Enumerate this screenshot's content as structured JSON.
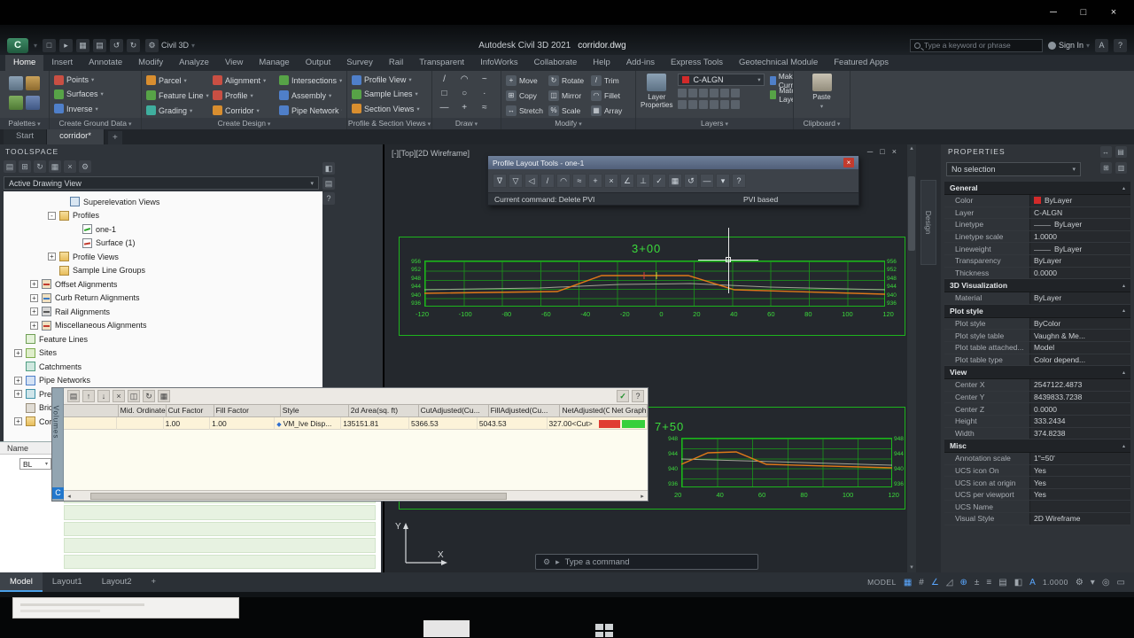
{
  "colors": {
    "accent_green": "#1db41d",
    "profile_design_line": "#e07818",
    "graph_red": "#e03c32",
    "graph_green": "#37d03c",
    "layer_swatch": "#d22a2a"
  },
  "window": {
    "minimize": "─",
    "maximize": "□",
    "close": "×"
  },
  "app": {
    "logo": "C",
    "qat_icons": [
      {
        "name": "new-file-icon",
        "g": "□"
      },
      {
        "name": "open-icon",
        "g": "▸"
      },
      {
        "name": "save-icon",
        "g": "▦"
      },
      {
        "name": "plot-icon",
        "g": "▤"
      },
      {
        "name": "undo-icon",
        "g": "↺"
      },
      {
        "name": "redo-icon",
        "g": "↻"
      }
    ],
    "workspace": "Civil 3D",
    "title": "Autodesk Civil 3D 2021",
    "doc": "corridor.dwg",
    "search_placeholder": "Type a keyword or phrase",
    "sign_in": "Sign In"
  },
  "ribbon": {
    "tabs": [
      {
        "label": "Home",
        "cls": "active"
      },
      {
        "label": "Insert"
      },
      {
        "label": "Annotate"
      },
      {
        "label": "Modify"
      },
      {
        "label": "Analyze"
      },
      {
        "label": "View"
      },
      {
        "label": "Manage"
      },
      {
        "label": "Output"
      },
      {
        "label": "Survey"
      },
      {
        "label": "Rail"
      },
      {
        "label": "Transparent"
      },
      {
        "label": "InfoWorks"
      },
      {
        "label": "Collaborate"
      },
      {
        "label": "Help"
      },
      {
        "label": "Add-ins"
      },
      {
        "label": "Express Tools"
      },
      {
        "label": "Geotechnical Module"
      },
      {
        "label": "Featured Apps"
      }
    ],
    "palettes": {
      "label": "Palettes"
    },
    "ground": {
      "label": "Create Ground Data",
      "buttons": [
        {
          "label": "Points",
          "c": "r"
        },
        {
          "label": "Surfaces",
          "c": "g"
        },
        {
          "label": "Inverse",
          "c": "b"
        }
      ]
    },
    "design": {
      "label": "Create Design",
      "buttons": [
        {
          "label": "Parcel",
          "c": "o"
        },
        {
          "label": "Alignment",
          "c": "r"
        },
        {
          "label": "Intersections",
          "c": "g"
        },
        {
          "label": "Feature Line",
          "c": "g"
        },
        {
          "label": "Profile",
          "c": "r"
        },
        {
          "label": "Assembly",
          "c": "b"
        },
        {
          "label": "Grading",
          "c": "t"
        },
        {
          "label": "Corridor",
          "c": "o"
        },
        {
          "label": "Pipe Network",
          "c": "b"
        }
      ]
    },
    "psv": {
      "label": "Profile & Section Views",
      "buttons": [
        {
          "label": "Profile View",
          "c": "b"
        },
        {
          "label": "Sample Lines",
          "c": "g"
        },
        {
          "label": "Section Views",
          "c": "o"
        }
      ]
    },
    "draw": {
      "label": "Draw",
      "glyphs": [
        "/",
        "◠",
        "~",
        "□",
        "○",
        "·",
        "—",
        "+",
        "≈"
      ]
    },
    "modify": {
      "label": "Modify",
      "buttons": [
        {
          "label": "Move",
          "g": "+"
        },
        {
          "label": "Rotate",
          "g": "↻"
        },
        {
          "label": "Trim",
          "g": "/"
        },
        {
          "label": "Copy",
          "g": "⊞"
        },
        {
          "label": "Mirror",
          "g": "◫"
        },
        {
          "label": "Fillet",
          "g": "◠"
        },
        {
          "label": "Stretch",
          "g": "↔"
        },
        {
          "label": "Scale",
          "g": "%"
        },
        {
          "label": "Array",
          "g": "▦"
        }
      ]
    },
    "layers": {
      "label": "Layers",
      "big_button": "Layer Properties",
      "layer_combo": "C-ALGN",
      "make_current": "Make Current",
      "match_layer": "Match Layer"
    },
    "clipboard": {
      "label": "Clipboard",
      "big_button": "Paste"
    }
  },
  "filetabs": [
    {
      "label": "Start"
    },
    {
      "label": "corridor*",
      "cls": "active"
    }
  ],
  "toolspace": {
    "title": "TOOLSPACE",
    "toolbar_icons": [
      {
        "name": "open-drawing-icon",
        "g": "▤"
      },
      {
        "name": "add-item-icon",
        "g": "⊞"
      },
      {
        "name": "refresh-icon",
        "g": "↻"
      },
      {
        "name": "panorama-icon",
        "g": "▦"
      },
      {
        "name": "close-icon",
        "g": "×"
      },
      {
        "name": "settings-icon",
        "g": "⚙"
      }
    ],
    "side_icons": [
      {
        "name": "auto-hide-icon",
        "g": "◧"
      },
      {
        "name": "properties-icon",
        "g": "▤"
      },
      {
        "name": "help-icon",
        "g": "?"
      }
    ],
    "combo": "Active Drawing View",
    "tree": [
      {
        "ind": 62,
        "exp": "",
        "ic": "sup",
        "label": "Superelevation Views"
      },
      {
        "ind": 50,
        "exp": "-",
        "ic": "fold",
        "label": "Profiles"
      },
      {
        "ind": 76,
        "exp": "",
        "ic": "prof",
        "label": "one-1"
      },
      {
        "ind": 76,
        "exp": "",
        "ic": "prof2",
        "label": "Surface (1)"
      },
      {
        "ind": 50,
        "exp": "+",
        "ic": "fold",
        "label": "Profile Views"
      },
      {
        "ind": 50,
        "exp": "",
        "ic": "fold",
        "label": "Sample Line Groups"
      },
      {
        "ind": 30,
        "exp": "+",
        "ic": "al",
        "label": "Offset Alignments"
      },
      {
        "ind": 30,
        "exp": "+",
        "ic": "al2",
        "label": "Curb Return Alignments"
      },
      {
        "ind": 30,
        "exp": "+",
        "ic": "rail",
        "label": "Rail Alignments"
      },
      {
        "ind": 30,
        "exp": "+",
        "ic": "al",
        "label": "Miscellaneous Alignments"
      },
      {
        "ind": 12,
        "exp": "",
        "ic": "fl",
        "label": "Feature Lines"
      },
      {
        "ind": 12,
        "exp": "+",
        "ic": "site",
        "label": "Sites"
      },
      {
        "ind": 12,
        "exp": "",
        "ic": "catch",
        "label": "Catchments"
      },
      {
        "ind": 12,
        "exp": "+",
        "ic": "pipe",
        "label": "Pipe Networks"
      },
      {
        "ind": 12,
        "exp": "+",
        "ic": "pres",
        "label": "Pressure Networks"
      },
      {
        "ind": 12,
        "exp": "",
        "ic": "br",
        "label": "Bridges"
      },
      {
        "ind": 12,
        "exp": "+",
        "ic": "fold",
        "label": "Corridors"
      }
    ]
  },
  "sheet": {
    "header": "Name",
    "cell": "BL"
  },
  "drawing": {
    "viewport_label": "[-][Top][2D Wireframe]",
    "window_controls": [
      "─",
      "□",
      "×"
    ],
    "profile1": {
      "title": "3+00",
      "x": [
        "-120",
        "-100",
        "-80",
        "-60",
        "-40",
        "-20",
        "0",
        "20",
        "40",
        "60",
        "80",
        "100",
        "120"
      ],
      "elev": [
        "956",
        "952",
        "948",
        "944",
        "940",
        "936"
      ]
    },
    "profile2": {
      "title": "7+50",
      "x": [
        "20",
        "40",
        "60",
        "80",
        "100",
        "120"
      ],
      "elev": [
        "948",
        "944",
        "940",
        "936"
      ]
    },
    "ucs": {
      "x": "X",
      "y": "Y"
    },
    "command": {
      "prompt": "Type a command"
    }
  },
  "pltools": {
    "title": "Profile Layout Tools - one-1",
    "close": "×",
    "icons": [
      "∇",
      "▽",
      "◁",
      "/",
      "◠",
      "≈",
      "+",
      "×",
      "∠",
      "⊥",
      "✓",
      "▦",
      "↺",
      "—",
      "▾",
      "?"
    ],
    "status_left": "Current command: Delete PVI",
    "status_right": "PVI based"
  },
  "panorama": {
    "tab": "Volumes",
    "badge": "C",
    "toolbar": [
      "▤",
      "↑",
      "↓",
      "×",
      "◫",
      "↻",
      "▦"
    ],
    "check": "✓",
    "help": "?",
    "columns": [
      {
        "label": ""
      },
      {
        "label": "Mid. Ordinate..."
      },
      {
        "label": "Cut Factor"
      },
      {
        "label": "Fill Factor"
      },
      {
        "label": "Style"
      },
      {
        "label": "2d Area(sq. ft)"
      },
      {
        "label": "CutAdjusted(Cu..."
      },
      {
        "label": "FillAdjusted(Cu..."
      },
      {
        "label": "NetAdjusted(Cu..."
      },
      {
        "label": "Net Graph"
      }
    ],
    "row": [
      {
        "t": ""
      },
      {
        "t": ""
      },
      {
        "t": "1.00"
      },
      {
        "t": "1.00"
      },
      {
        "t": "VM_lve Disp...",
        "k": "style"
      },
      {
        "t": "135151.81"
      },
      {
        "t": "5366.53"
      },
      {
        "t": "5043.53"
      },
      {
        "t": "327.00<Cut>"
      },
      {
        "t": "",
        "k": "graph"
      }
    ]
  },
  "sidestrip": {
    "tab": "Design"
  },
  "properties": {
    "title": "PROPERTIES",
    "selector": "No selection",
    "rows": [
      {
        "k": "sec",
        "label": "General",
        "value": ""
      },
      {
        "k": "color",
        "label": "Color",
        "value": "ByLayer"
      },
      {
        "k": "row",
        "label": "Layer",
        "value": "C-ALGN"
      },
      {
        "k": "line",
        "label": "Linetype",
        "value": "ByLayer"
      },
      {
        "k": "row",
        "label": "Linetype scale",
        "value": "1.0000"
      },
      {
        "k": "line",
        "label": "Lineweight",
        "value": "ByLayer"
      },
      {
        "k": "row",
        "label": "Transparency",
        "value": "ByLayer"
      },
      {
        "k": "row",
        "label": "Thickness",
        "value": "0.0000"
      },
      {
        "k": "sec",
        "label": "3D Visualization",
        "value": ""
      },
      {
        "k": "row",
        "label": "Material",
        "value": "ByLayer"
      },
      {
        "k": "sec",
        "label": "Plot style",
        "value": ""
      },
      {
        "k": "row",
        "label": "Plot style",
        "value": "ByColor"
      },
      {
        "k": "row",
        "label": "Plot style table",
        "value": "Vaughn & Me..."
      },
      {
        "k": "row",
        "label": "Plot table attached...",
        "value": "Model"
      },
      {
        "k": "row",
        "label": "Plot table type",
        "value": "Color depend..."
      },
      {
        "k": "sec",
        "label": "View",
        "value": ""
      },
      {
        "k": "row",
        "label": "Center X",
        "value": "2547122.4873"
      },
      {
        "k": "row",
        "label": "Center Y",
        "value": "8439833.7238"
      },
      {
        "k": "row",
        "label": "Center Z",
        "value": "0.0000"
      },
      {
        "k": "row",
        "label": "Height",
        "value": "333.2434"
      },
      {
        "k": "row",
        "label": "Width",
        "value": "374.8238"
      },
      {
        "k": "sec",
        "label": "Misc",
        "value": ""
      },
      {
        "k": "row",
        "label": "Annotation scale",
        "value": "1\"=50'"
      },
      {
        "k": "row",
        "label": "UCS icon On",
        "value": "Yes"
      },
      {
        "k": "row",
        "label": "UCS icon at origin",
        "value": "Yes"
      },
      {
        "k": "row",
        "label": "UCS per viewport",
        "value": "Yes"
      },
      {
        "k": "row",
        "label": "UCS Name",
        "value": ""
      },
      {
        "k": "row",
        "label": "Visual Style",
        "value": "2D Wireframe"
      }
    ]
  },
  "statusbar": {
    "tabs": [
      {
        "label": "Model",
        "cls": "active"
      },
      {
        "label": "Layout1"
      },
      {
        "label": "Layout2"
      },
      {
        "label": "+"
      }
    ],
    "icons": [
      {
        "g": "MODEL",
        "cls": "txt"
      },
      {
        "g": "▦",
        "cls": "on"
      },
      {
        "g": "#"
      },
      {
        "g": "∠",
        "cls": "on"
      },
      {
        "g": "◿"
      },
      {
        "g": "⊕",
        "cls": "on"
      },
      {
        "g": "±"
      },
      {
        "g": "≡"
      },
      {
        "g": "▤"
      },
      {
        "g": "◧"
      },
      {
        "g": "A",
        "cls": "on"
      },
      {
        "g": "1.0000",
        "cls": "txt"
      },
      {
        "g": "⚙"
      },
      {
        "g": "▾"
      },
      {
        "g": "◎"
      },
      {
        "g": "▭"
      }
    ]
  }
}
